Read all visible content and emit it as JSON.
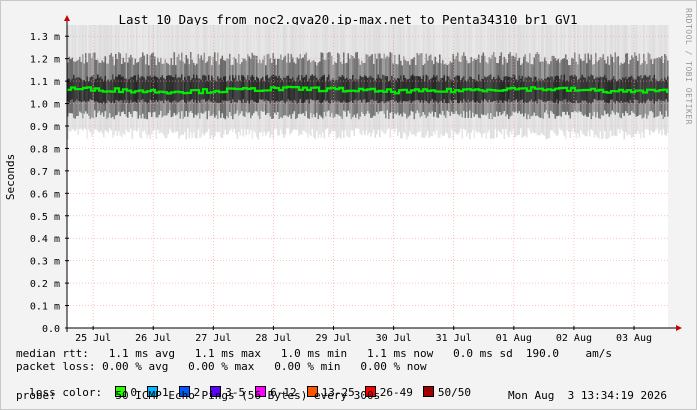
{
  "credit": "RRDTOOL / TOBI OETIKER",
  "chart_data": {
    "type": "line",
    "title": "Last 10 Days from noc2.gva20.ip-max.net to Penta34310_br1_GV1",
    "ylabel": "Seconds",
    "xlabel": "",
    "ylim": [
      0,
      1.35
    ],
    "yticks": [
      {
        "v": 0.0,
        "label": "0.0"
      },
      {
        "v": 0.1,
        "label": "0.1 m"
      },
      {
        "v": 0.2,
        "label": "0.2 m"
      },
      {
        "v": 0.3,
        "label": "0.3 m"
      },
      {
        "v": 0.4,
        "label": "0.4 m"
      },
      {
        "v": 0.5,
        "label": "0.5 m"
      },
      {
        "v": 0.6,
        "label": "0.6 m"
      },
      {
        "v": 0.7,
        "label": "0.7 m"
      },
      {
        "v": 0.8,
        "label": "0.8 m"
      },
      {
        "v": 0.9,
        "label": "0.9 m"
      },
      {
        "v": 1.0,
        "label": "1.0 m"
      },
      {
        "v": 1.1,
        "label": "1.1 m"
      },
      {
        "v": 1.2,
        "label": "1.2 m"
      },
      {
        "v": 1.3,
        "label": "1.3 m"
      }
    ],
    "xlim": [
      "2026-07-24T13:34",
      "2026-08-03T13:34"
    ],
    "xticks": [
      {
        "x": "2026-07-25T00:00",
        "label": "25 Jul"
      },
      {
        "x": "2026-07-26T00:00",
        "label": "26 Jul"
      },
      {
        "x": "2026-07-27T00:00",
        "label": "27 Jul"
      },
      {
        "x": "2026-07-28T00:00",
        "label": "28 Jul"
      },
      {
        "x": "2026-07-29T00:00",
        "label": "29 Jul"
      },
      {
        "x": "2026-07-30T00:00",
        "label": "30 Jul"
      },
      {
        "x": "2026-07-31T00:00",
        "label": "31 Jul"
      },
      {
        "x": "2026-08-01T00:00",
        "label": "01 Aug"
      },
      {
        "x": "2026-08-02T00:00",
        "label": "02 Aug"
      },
      {
        "x": "2026-08-03T00:00",
        "label": "03 Aug"
      }
    ],
    "median_rtt_ms": 1.06,
    "rtt_band_ms": [
      0.84,
      1.35
    ],
    "loss_pct": 0,
    "grid": true
  },
  "colors": {
    "median": "#00ee00",
    "grid": "#ff9999",
    "axis": "#cc0000",
    "band": "#333333",
    "loss_0": "#26ff00",
    "loss_1": "#00b8ff",
    "loss_2": "#0059ff",
    "loss_3_5": "#5e00ff",
    "loss_6_12": "#ff00ff",
    "loss_13_25": "#ff5500",
    "loss_26_49": "#ff0000",
    "loss_50_50": "#a10000"
  },
  "stats": {
    "median_rtt": "median rtt:   1.1 ms avg   1.1 ms max   1.0 ms min   1.1 ms now   0.0 ms sd  190.0    am/s",
    "packet_loss": "packet loss: 0.00 % avg   0.00 % max   0.00 % min   0.00 % now"
  },
  "loss_legend": {
    "label": "loss color:",
    "items": [
      {
        "label": "0",
        "color": "#26ff00"
      },
      {
        "label": "1",
        "color": "#00b8ff"
      },
      {
        "label": "2",
        "color": "#0059ff"
      },
      {
        "label": "3-5",
        "color": "#5e00ff"
      },
      {
        "label": "6-12",
        "color": "#ff00ff"
      },
      {
        "label": "13-25",
        "color": "#ff5500"
      },
      {
        "label": "26-49",
        "color": "#ff0000"
      },
      {
        "label": "50/50",
        "color": "#a10000"
      }
    ]
  },
  "probe": {
    "label": "probe:",
    "description": "50 ICMP Echo Pings (56 Bytes) every 300s",
    "timestamp": "Mon Aug  3 13:34:19 2026"
  }
}
